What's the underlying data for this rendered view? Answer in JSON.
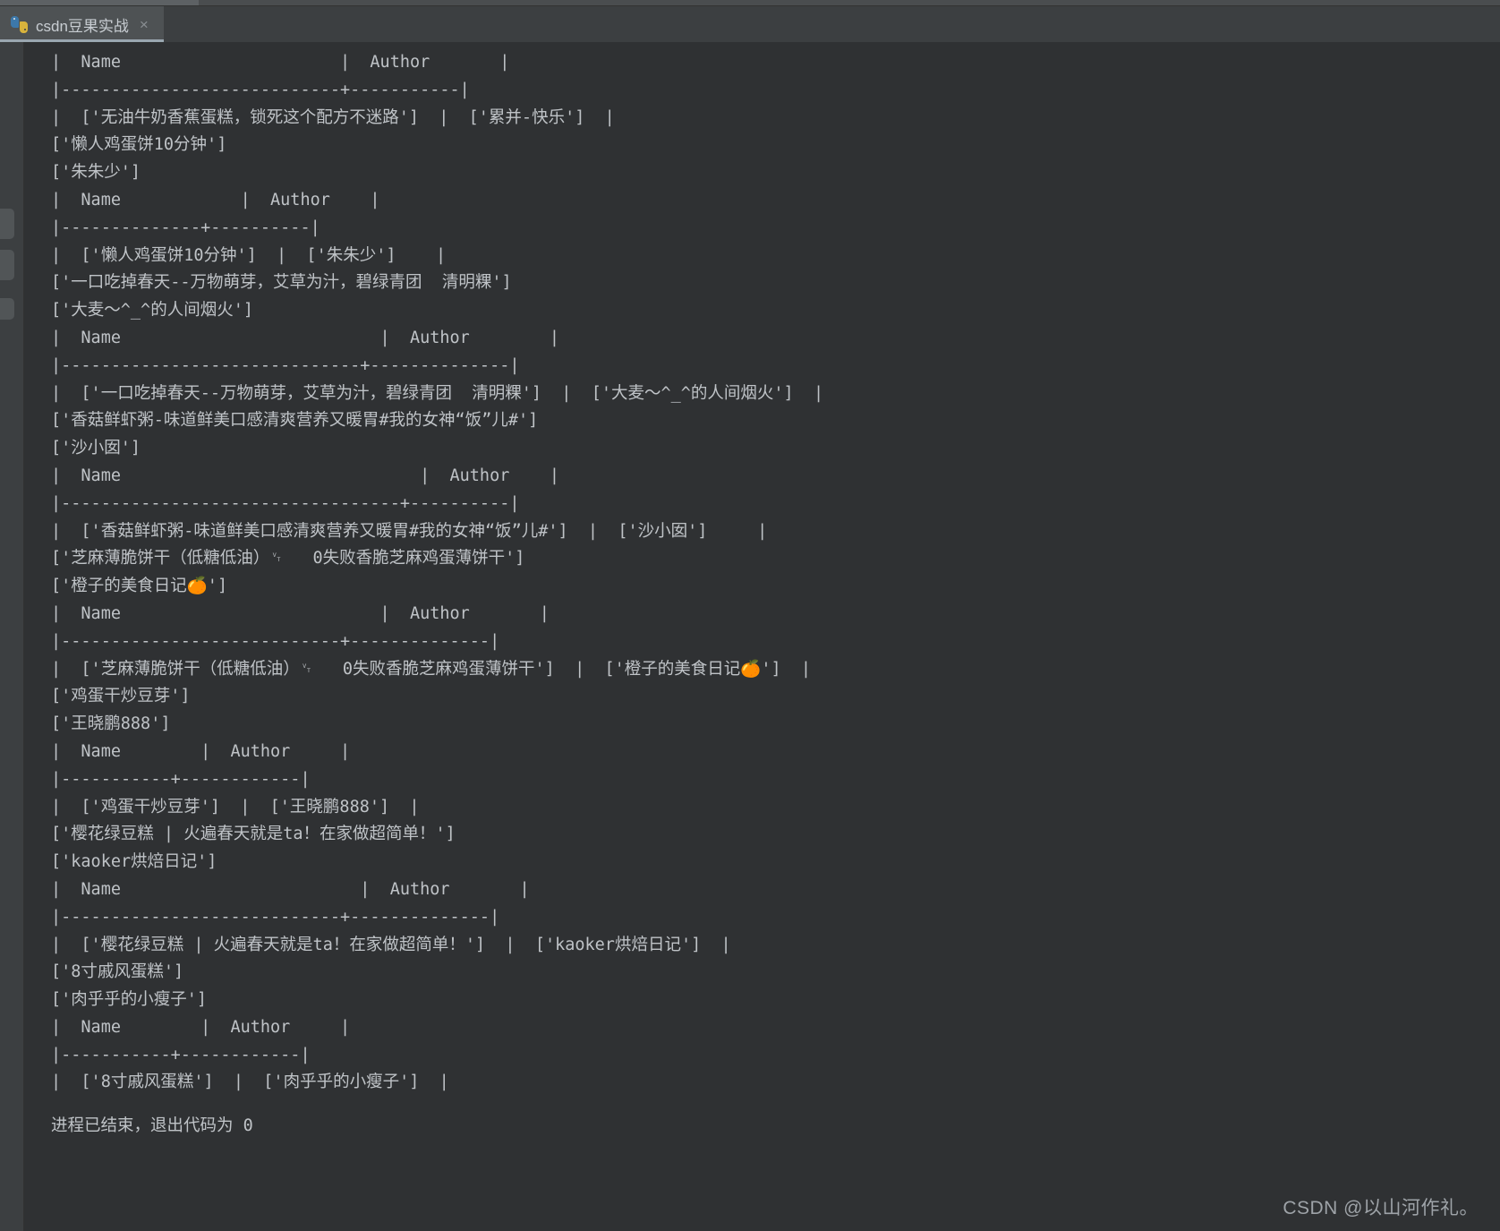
{
  "window": {
    "background_color": "#3c3f41",
    "console_background_color": "#2f3133",
    "text_color": "#bfc3c7"
  },
  "tab_bar": {
    "active_tab": {
      "icon": "python-file-icon",
      "title": "csdn豆果实战",
      "close_label": "×"
    }
  },
  "gutter": {
    "stub_labels": [
      "gutter-tab-1",
      "gutter-tab-2",
      "gutter-tab-3"
    ]
  },
  "console": {
    "output": "|  Name                      |  Author       |\n|----------------------------+-----------|\n|  ['无油牛奶香蕉蛋糕，锁死这个配方不迷路']  |  ['累并-快乐']  |\n['懒人鸡蛋饼10分钟']\n['朱朱少']\n|  Name            |  Author    |\n|--------------+----------|\n|  ['懒人鸡蛋饼10分钟']  |  ['朱朱少']    |\n['一口吃掉春天--万物萌芽，艾草为汁，碧绿青团  清明粿']\n['大麦～^_^的人间烟火']\n|  Name                          |  Author        |\n|------------------------------+--------------|\n|  ['一口吃掉春天--万物萌芽，艾草为汁，碧绿青团  清明粿']  |  ['大麦～^_^的人间烟火']  |\n['香菇鲜虾粥-味道鲜美口感清爽营养又暖胃#我的女神“饭”儿#']\n['沙小囡']\n|  Name                              |  Author    |\n|----------------------------------+----------|\n|  ['香菇鲜虾粥-味道鲜美口感清爽营养又暖胃#我的女神“饭”儿#']  |  ['沙小囡']     |\n['芝麻薄脆饼干（低糖低油）␋   0失败香脆芝麻鸡蛋薄饼干']\n['橙子的美食日记🍊']\n|  Name                          |  Author       |\n|----------------------------+--------------|\n|  ['芝麻薄脆饼干（低糖低油）␋   0失败香脆芝麻鸡蛋薄饼干']  |  ['橙子的美食日记🍊']  |\n['鸡蛋干炒豆芽']\n['王晓鹏888']\n|  Name        |  Author     |\n|-----------+------------|\n|  ['鸡蛋干炒豆芽']  |  ['王晓鹏888']  |\n['樱花绿豆糕 | 火遍春天就是ta！在家做超简单！']\n['kaoker烘焙日记']\n|  Name                        |  Author       |\n|----------------------------+--------------|\n|  ['樱花绿豆糕 | 火遍春天就是ta！在家做超简单！']  |  ['kaoker烘焙日记']  |\n['8寸戚风蛋糕']\n['肉乎乎的小瘦子']\n|  Name        |  Author     |\n|-----------+------------|\n|  ['8寸戚风蛋糕']  |  ['肉乎乎的小瘦子']  |",
    "exit_message": "进程已结束，退出代码为 0"
  },
  "watermark": {
    "text": "CSDN @以山河作礼。"
  }
}
